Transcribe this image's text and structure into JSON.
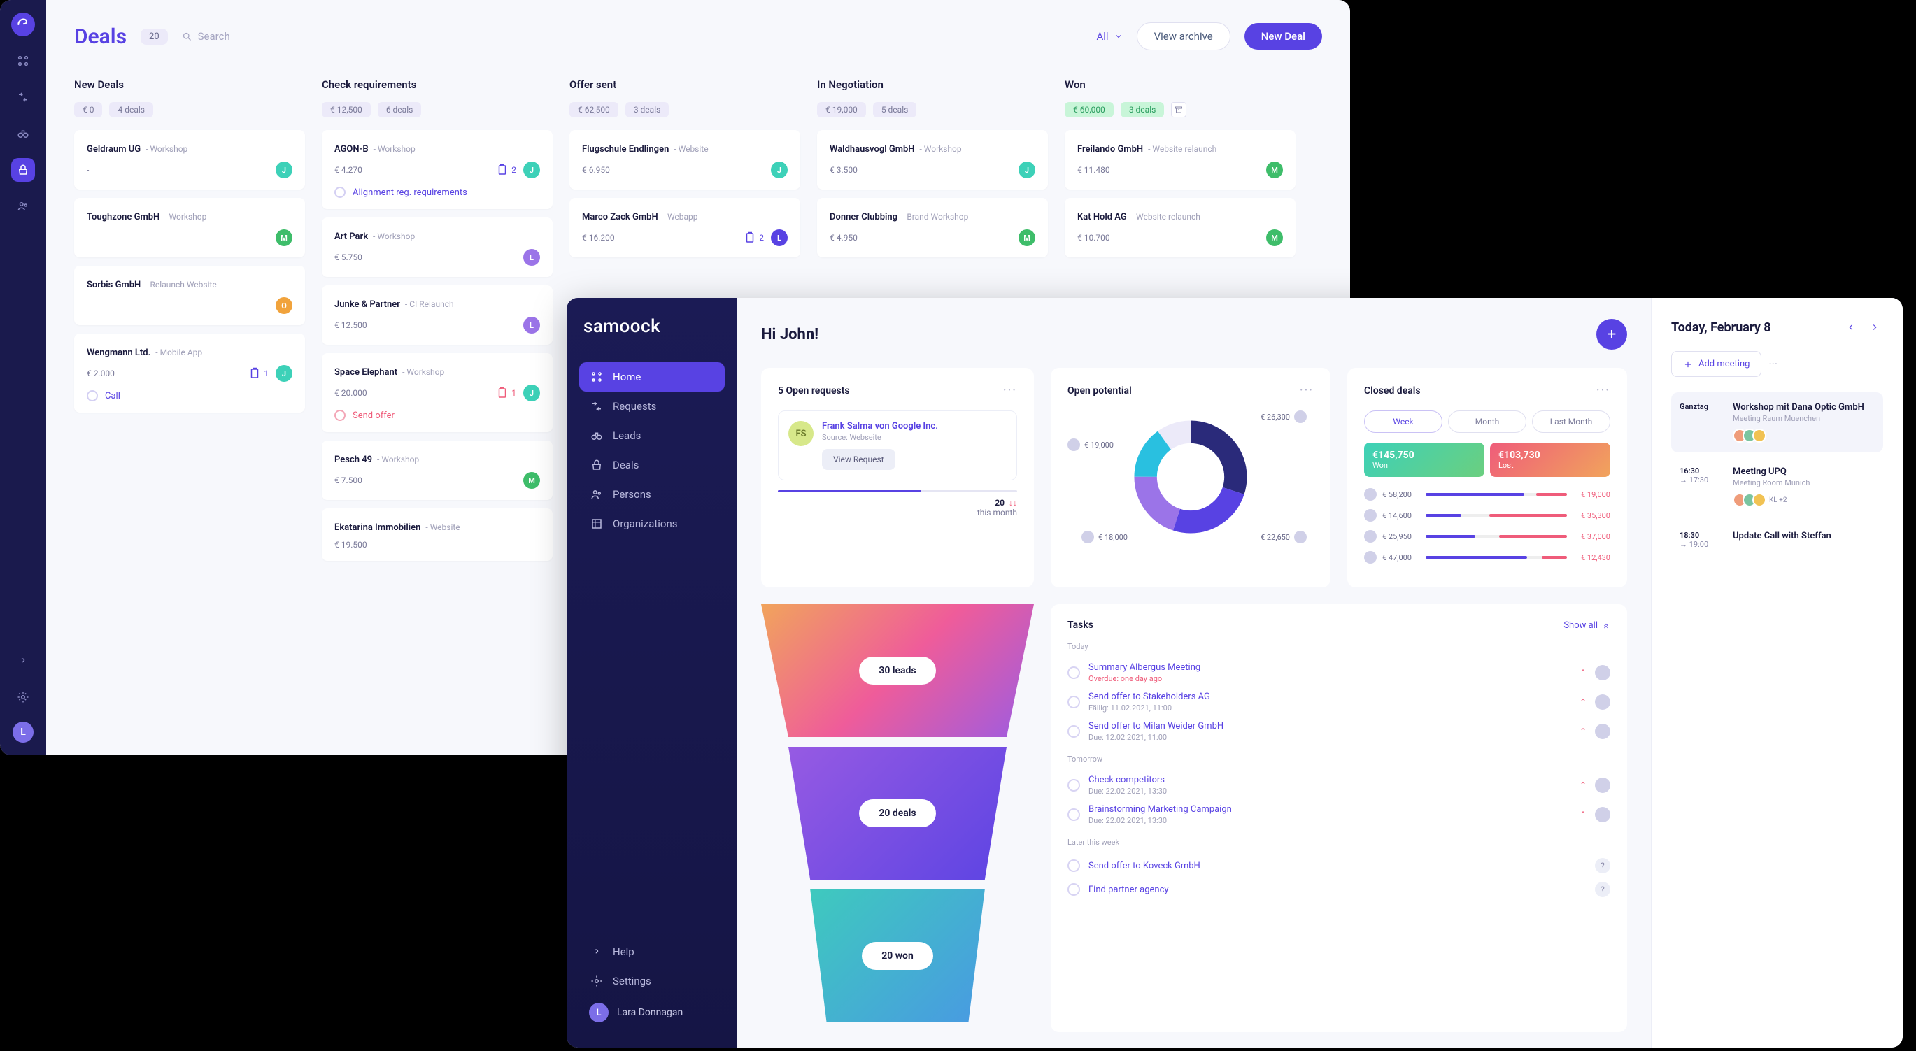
{
  "deals": {
    "title": "Deals",
    "count": "20",
    "search_placeholder": "Search",
    "filter_label": "All",
    "view_archive": "View archive",
    "new_deal": "New Deal",
    "sidebar_user_initial": "L",
    "columns": [
      {
        "title": "New Deals",
        "total": "€ 0",
        "count": "4 deals",
        "cards": [
          {
            "company": "Geldraum UG",
            "sub": "Workshop",
            "amount": "-",
            "avatar": "J",
            "color": "c-teal"
          },
          {
            "company": "Toughzone GmbH",
            "sub": "Workshop",
            "amount": "-",
            "avatar": "M",
            "color": "c-green"
          },
          {
            "company": "Sorbis GmbH",
            "sub": "Relaunch Website",
            "amount": "-",
            "avatar": "O",
            "color": "c-orange"
          },
          {
            "company": "Wengmann Ltd.",
            "sub": "Mobile App",
            "amount": "€ 2.000",
            "avatar": "J",
            "color": "c-teal",
            "task_count": "1",
            "subtask": "Call"
          }
        ]
      },
      {
        "title": "Check requirements",
        "total": "€ 12,500",
        "count": "6 deals",
        "cards": [
          {
            "company": "AGON-B",
            "sub": "Workshop",
            "amount": "€ 4.270",
            "avatar": "J",
            "color": "c-teal",
            "task_count": "2",
            "subtask": "Alignment reg. requirements"
          },
          {
            "company": "Art Park",
            "sub": "Workshop",
            "amount": "€ 5.750",
            "avatar": "L",
            "color": "c-purple"
          },
          {
            "company": "Junke & Partner",
            "sub": "CI Relaunch",
            "amount": "€ 12.500",
            "avatar": "L",
            "color": "c-purple"
          },
          {
            "company": "Space Elephant",
            "sub": "Workshop",
            "amount": "€ 20.000",
            "avatar": "J",
            "color": "c-teal",
            "task_count": "1",
            "task_red": true,
            "subtask": "Send offer",
            "sub_red": true
          },
          {
            "company": "Pesch 49",
            "sub": "Workshop",
            "amount": "€ 7.500",
            "avatar": "M",
            "color": "c-green"
          },
          {
            "company": "Ekatarina Immobilien",
            "sub": "Website",
            "amount": "€ 19.500"
          }
        ]
      },
      {
        "title": "Offer sent",
        "total": "€ 62,500",
        "count": "3 deals",
        "cards": [
          {
            "company": "Flugschule Endlingen",
            "sub": "Website",
            "amount": "€ 6.950",
            "avatar": "J",
            "color": "c-teal"
          },
          {
            "company": "Marco Zack GmbH",
            "sub": "Webapp",
            "amount": "€ 16.200",
            "avatar": "L",
            "color": "c-deep",
            "task_count": "2"
          }
        ]
      },
      {
        "title": "In Negotiation",
        "total": "€ 19,000",
        "count": "5 deals",
        "cards": [
          {
            "company": "Waldhausvogl GmbH",
            "sub": "Workshop",
            "amount": "€ 3.500",
            "avatar": "J",
            "color": "c-teal"
          },
          {
            "company": "Donner Clubbing",
            "sub": "Brand Workshop",
            "amount": "€ 4.950",
            "avatar": "M",
            "color": "c-green"
          }
        ]
      },
      {
        "title": "Won",
        "total": "€ 60,000",
        "count": "3 deals",
        "won": true,
        "cards": [
          {
            "company": "Freilando GmbH",
            "sub": "Website relaunch",
            "amount": "€ 11.480",
            "avatar": "M",
            "color": "c-green"
          },
          {
            "company": "Kat Hold AG",
            "sub": "Website relaunch",
            "amount": "€ 10.700",
            "avatar": "M",
            "color": "c-green"
          }
        ]
      }
    ]
  },
  "dashboard": {
    "brand": "samoock",
    "nav": [
      "Home",
      "Requests",
      "Leads",
      "Deals",
      "Persons",
      "Organizations"
    ],
    "help": "Help",
    "settings": "Settings",
    "user": "Lara Donnagan",
    "user_initial": "L",
    "greeting": "Hi John!",
    "requests": {
      "title": "5 Open requests",
      "name": "Frank Salma von Google Inc.",
      "source": "Source: Webseite",
      "avatar": "FS",
      "button": "View Request",
      "trend_value": "20",
      "trend_label": "this month"
    },
    "potential": {
      "title": "Open potential",
      "labels": [
        {
          "amount": "€ 26,300"
        },
        {
          "amount": "€ 19,000"
        },
        {
          "amount": "€ 18,000"
        },
        {
          "amount": "€ 22,650"
        }
      ]
    },
    "closed": {
      "title": "Closed deals",
      "segments": [
        "Week",
        "Month",
        "Last Month"
      ],
      "won": {
        "amount": "€145,750",
        "label": "Won"
      },
      "lost": {
        "amount": "€103,730",
        "label": "Lost"
      },
      "rows": [
        {
          "l": "€ 58,200",
          "r": "€ 19,000",
          "wp": 70,
          "lp": 22
        },
        {
          "l": "€ 14,600",
          "r": "€ 35,300",
          "wp": 25,
          "lp": 55
        },
        {
          "l": "€ 25,950",
          "r": "€ 37,000",
          "wp": 35,
          "lp": 48
        },
        {
          "l": "€ 47,000",
          "r": "€ 12,430",
          "wp": 72,
          "lp": 18
        }
      ]
    },
    "funnel": [
      "30 leads",
      "20 deals",
      "20 won"
    ],
    "tasks": {
      "title": "Tasks",
      "show_all": "Show all",
      "sections": [
        {
          "label": "Today",
          "items": [
            {
              "name": "Summary Albergus Meeting",
              "due": "Overdue: one day ago",
              "due_red": true,
              "pri": true
            },
            {
              "name": "Send offer to Stakeholders AG",
              "due": "Fällig: 11.02.2021, 11:00",
              "pri": true
            },
            {
              "name": "Send offer to Milan Weider GmbH",
              "due": "Due: 12.02.2021, 11:00",
              "pri": true
            }
          ]
        },
        {
          "label": "Tomorrow",
          "items": [
            {
              "name": "Check competitors",
              "due": "Due: 22.02.2021, 13:30",
              "pri": true
            },
            {
              "name": "Brainstorming Marketing Campaign",
              "due": "Due: 22.02.2021, 13:30",
              "pri": true
            }
          ]
        },
        {
          "label": "Later this week",
          "items": [
            {
              "name": "Send offer to Koveck GmbH",
              "q": true
            },
            {
              "name": "Find partner agency",
              "q": true
            }
          ]
        }
      ]
    },
    "agenda": {
      "title": "Today, February 8",
      "add_meeting": "Add meeting",
      "events": [
        {
          "time": "Ganztag",
          "end": "",
          "label": "",
          "title": "Workshop mit Dana Optic GmbH",
          "loc": "Meeting Raum Muenchen",
          "active": true,
          "avatars": 3
        },
        {
          "time": "16:30",
          "end": "→ 17:30",
          "title": "Meeting UPQ",
          "loc": "Meeting Room Munich",
          "avatars": 3,
          "more": "KL +2"
        },
        {
          "time": "18:30",
          "end": "→ 19:00",
          "title": "Update Call with Steffan"
        }
      ]
    }
  }
}
